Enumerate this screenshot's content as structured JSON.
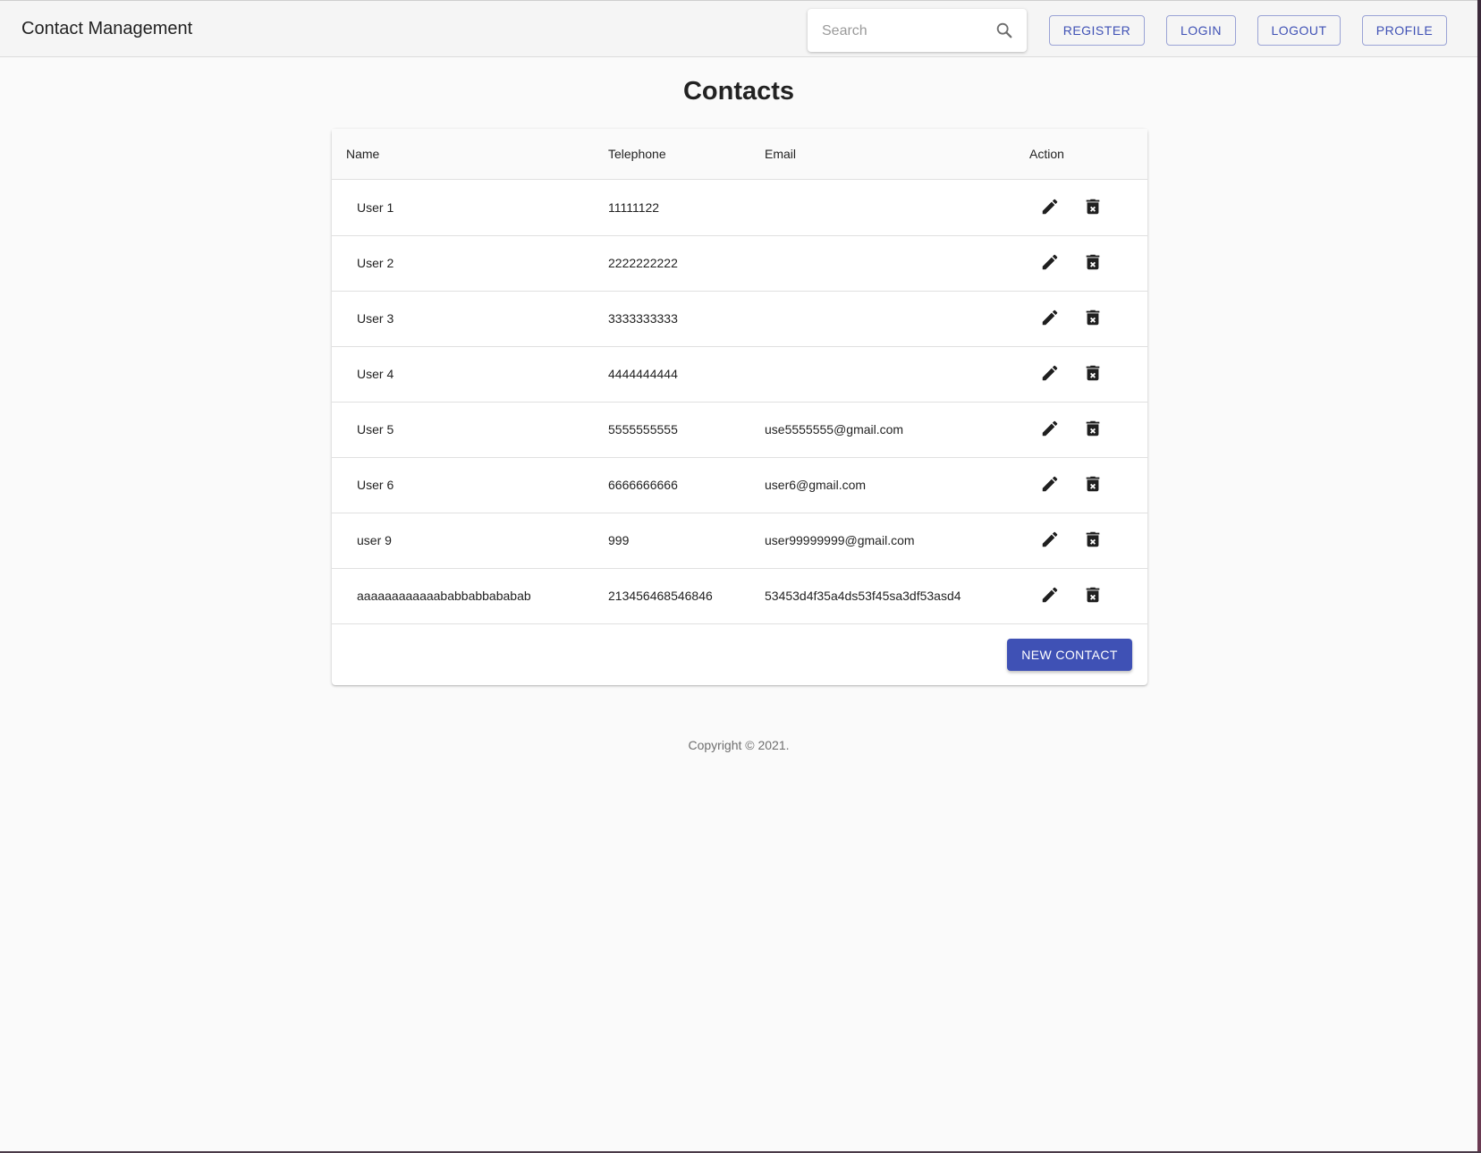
{
  "app": {
    "title": "Contact Management"
  },
  "search": {
    "placeholder": "Search",
    "value": ""
  },
  "nav": {
    "register": "REGISTER",
    "login": "LOGIN",
    "logout": "LOGOUT",
    "profile": "PROFILE"
  },
  "page": {
    "title": "Contacts"
  },
  "table": {
    "headers": {
      "name": "Name",
      "telephone": "Telephone",
      "email": "Email",
      "action": "Action"
    },
    "rows": [
      {
        "name": "User 1",
        "telephone": "11111122",
        "email": ""
      },
      {
        "name": "User 2",
        "telephone": "2222222222",
        "email": ""
      },
      {
        "name": "User 3",
        "telephone": "3333333333",
        "email": ""
      },
      {
        "name": "User 4",
        "telephone": "4444444444",
        "email": ""
      },
      {
        "name": "User 5",
        "telephone": "5555555555",
        "email": "use5555555@gmail.com"
      },
      {
        "name": "User 6",
        "telephone": "6666666666",
        "email": "user6@gmail.com"
      },
      {
        "name": "user 9",
        "telephone": "999",
        "email": "user99999999@gmail.com"
      },
      {
        "name": "aaaaaaaaaaaababbabbababab",
        "telephone": "213456468546846",
        "email": "53453d4f35a4ds53f45sa3df53asd4"
      }
    ],
    "row_icons": {
      "edit": "edit-pencil-icon",
      "delete": "delete-trash-icon"
    },
    "new_contact_label": "NEW CONTACT"
  },
  "footer": {
    "copyright": "Copyright © 2021."
  },
  "colors": {
    "primary": "#3f51b5",
    "appbar": "#f5f5f5",
    "background": "#fafafa"
  }
}
